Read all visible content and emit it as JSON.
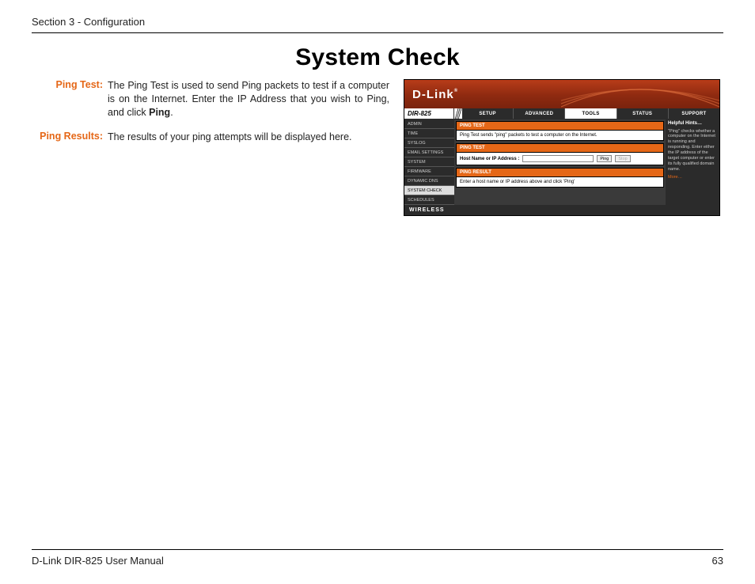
{
  "header": {
    "section": "Section 3 - Configuration"
  },
  "page_title": "System Check",
  "definitions": [
    {
      "term": "Ping Test:",
      "desc_pre": "The Ping Test is used to send Ping packets to test if a computer is on the Internet. Enter the IP Address that you wish to Ping, and click ",
      "desc_bold": "Ping",
      "desc_post": "."
    },
    {
      "term": "Ping Results:",
      "desc_pre": "The results of your ping attempts will be displayed here.",
      "desc_bold": "",
      "desc_post": ""
    }
  ],
  "screenshot": {
    "logo_text": "D-Link",
    "model": "DIR-825",
    "topnav": [
      "SETUP",
      "ADVANCED",
      "TOOLS",
      "STATUS",
      "SUPPORT"
    ],
    "topnav_active": "TOOLS",
    "sidenav": [
      "ADMIN",
      "TIME",
      "SYSLOG",
      "EMAIL SETTINGS",
      "SYSTEM",
      "FIRMWARE",
      "DYNAMIC DNS",
      "SYSTEM CHECK",
      "SCHEDULES"
    ],
    "sidenav_active": "SYSTEM CHECK",
    "panel_intro_title": "PING TEST",
    "panel_intro_body": "Ping Test sends \"ping\" packets to test a computer on the Internet.",
    "panel_form_title": "PING TEST",
    "panel_form_label": "Host Name or IP Address :",
    "btn_ping": "Ping",
    "btn_stop": "Stop",
    "panel_result_title": "PING RESULT",
    "panel_result_body": "Enter a host name or IP address above and click 'Ping'",
    "help_title": "Helpful Hints…",
    "help_body": "\"Ping\" checks whether a computer on the Internet is running and responding. Enter either the IP address of the target computer or enter its fully qualified domain name.",
    "help_more": "More…",
    "footer_brand": "WIRELESS"
  },
  "footer": {
    "manual": "D-Link DIR-825 User Manual",
    "page": "63"
  }
}
